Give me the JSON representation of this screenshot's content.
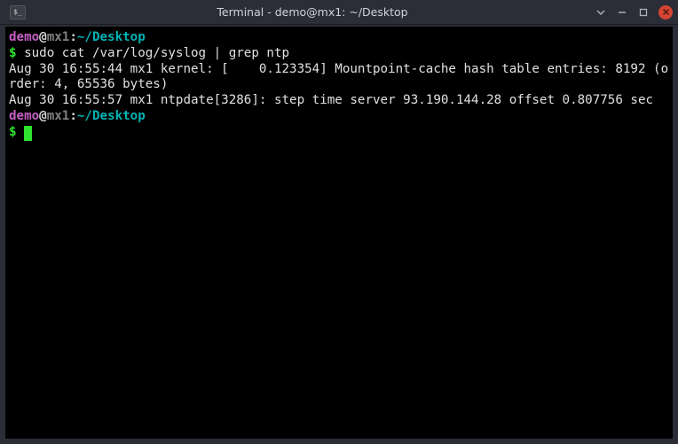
{
  "titlebar": {
    "title": "Terminal - demo@mx1: ~/Desktop"
  },
  "prompt": {
    "user": "demo",
    "at": "@",
    "host": "mx1",
    "colon": ":",
    "path": "~/Desktop",
    "symbol": "$"
  },
  "session": {
    "command1": "sudo cat /var/log/syslog | grep ntp",
    "output1": "Aug 30 16:55:44 mx1 kernel: [    0.123354] Mountpoint-cache hash table entries: 8192 (order: 4, 65536 bytes)",
    "output2": "Aug 30 16:55:57 mx1 ntpdate[3286]: step time server 93.190.144.28 offset 0.807756 sec"
  },
  "icons": {
    "term": "$_"
  }
}
